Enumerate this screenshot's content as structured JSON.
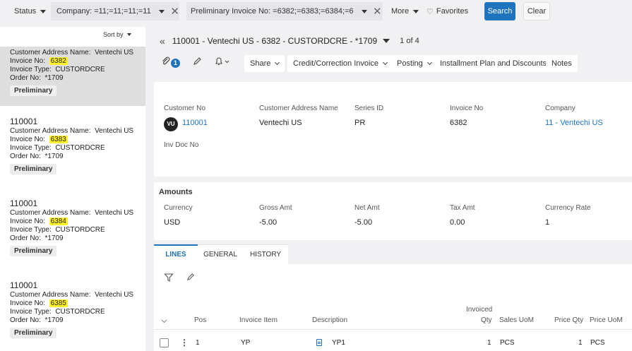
{
  "filters": {
    "status_label": "Status",
    "company_label": "Company: =11;=11;=11;=11",
    "invoice_label": "Preliminary Invoice No: =6382;=6383;=6384;=6",
    "more_label": "More",
    "favorites_label": "Favorites",
    "search_label": "Search",
    "clear_label": "Clear",
    "clear_glyph": "✕",
    "heart_glyph": "♡"
  },
  "list": {
    "sort_label": "Sort by",
    "cards": [
      {
        "id": "",
        "address_label": "Customer Address Name:",
        "address_value": "Ventechi US",
        "invoice_label": "Invoice No:",
        "invoice_value": "6382",
        "type_label": "Invoice Type:",
        "type_value": "CUSTORDCRE",
        "order_label": "Order No:",
        "order_value": "*1709",
        "status": "Preliminary"
      },
      {
        "id": "110001",
        "address_label": "Customer Address Name:",
        "address_value": "Ventechi US",
        "invoice_label": "Invoice No:",
        "invoice_value": "6383",
        "type_label": "Invoice Type:",
        "type_value": "CUSTORDCRE",
        "order_label": "Order No:",
        "order_value": "*1709",
        "status": "Preliminary"
      },
      {
        "id": "110001",
        "address_label": "Customer Address Name:",
        "address_value": "Ventechi US",
        "invoice_label": "Invoice No:",
        "invoice_value": "6384",
        "type_label": "Invoice Type:",
        "type_value": "CUSTORDCRE",
        "order_label": "Order No:",
        "order_value": "*1709",
        "status": "Preliminary"
      },
      {
        "id": "110001",
        "address_label": "Customer Address Name:",
        "address_value": "Ventechi US",
        "invoice_label": "Invoice No:",
        "invoice_value": "6385",
        "type_label": "Invoice Type:",
        "type_value": "CUSTORDCRE",
        "order_label": "Order No:",
        "order_value": "*1709",
        "status": "Preliminary"
      }
    ]
  },
  "header": {
    "back_glyph": "«",
    "title": "110001 - Ventechi US - 6382 - CUSTORDCRE - *1709",
    "pager": "1 of 4"
  },
  "toolbar": {
    "attachment_count": "1",
    "share": "Share",
    "credit": "Credit/Correction Invoice",
    "posting": "Posting",
    "installment": "Installment Plan and Discounts",
    "notes": "Notes"
  },
  "details": {
    "customer_no_label": "Customer No",
    "customer_no_value": "110001",
    "avatar_initials": "VU",
    "address_label": "Customer Address Name",
    "address_value": "Ventechi US",
    "series_label": "Series ID",
    "series_value": "PR",
    "invoice_label": "Invoice No",
    "invoice_value": "6382",
    "company_label": "Company",
    "company_value": "11 - Ventechi US",
    "inv_doc_label": "Inv Doc No"
  },
  "amounts": {
    "title": "Amounts",
    "currency_label": "Currency",
    "currency_value": "USD",
    "gross_label": "Gross Amt",
    "gross_value": "-5.00",
    "net_label": "Net Amt",
    "net_value": "-5.00",
    "tax_label": "Tax Amt",
    "tax_value": "0.00",
    "rate_label": "Currency Rate",
    "rate_value": "1"
  },
  "lines": {
    "tabs": [
      "LINES",
      "GENERAL",
      "HISTORY"
    ],
    "columns": {
      "pos": "Pos",
      "item": "Invoice Item",
      "description": "Description",
      "invoiced_top": "Invoiced",
      "invoiced_bottom": "Qty",
      "sales_uom": "Sales UoM",
      "price_qty": "Price Qty",
      "price_uom": "Price UoM"
    },
    "rows": [
      {
        "pos": "1",
        "item": "YP",
        "description": "YP1",
        "qty": "1",
        "sales_uom": "PCS",
        "price_qty": "1",
        "price_uom": "PCS"
      }
    ]
  }
}
